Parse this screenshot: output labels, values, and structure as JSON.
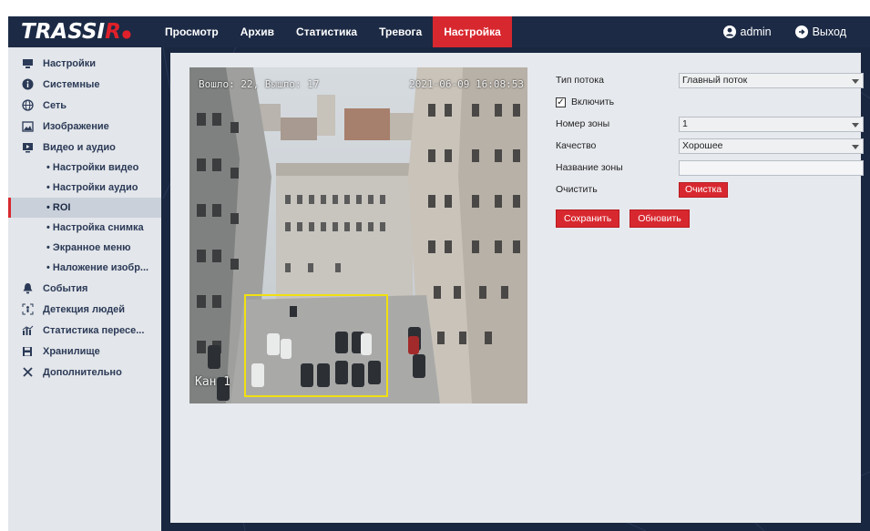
{
  "brand": {
    "logo_main": "TRASSI",
    "logo_accent": "R"
  },
  "nav": {
    "items": [
      {
        "label": "Просмотр"
      },
      {
        "label": "Архив"
      },
      {
        "label": "Статистика"
      },
      {
        "label": "Тревога"
      },
      {
        "label": "Настройка"
      }
    ],
    "active_index": 4,
    "user_label": "admin",
    "logout_label": "Выход"
  },
  "sidebar": {
    "items": [
      {
        "label": "Настройки",
        "icon": "monitor-icon"
      },
      {
        "label": "Системные",
        "icon": "info-icon"
      },
      {
        "label": "Сеть",
        "icon": "globe-icon"
      },
      {
        "label": "Изображение",
        "icon": "image-icon"
      },
      {
        "label": "Видео и аудио",
        "icon": "video-icon"
      }
    ],
    "video_sub": [
      {
        "label": "• Настройки видео"
      },
      {
        "label": "• Настройки аудио"
      },
      {
        "label": "• ROI"
      },
      {
        "label": "• Настройка снимка"
      },
      {
        "label": "• Экранное меню"
      },
      {
        "label": "• Наложение изобр..."
      }
    ],
    "active_sub_index": 2,
    "items_after": [
      {
        "label": "События",
        "icon": "bell-icon"
      },
      {
        "label": "Детекция людей",
        "icon": "person-detect-icon"
      },
      {
        "label": "Статистика пересе...",
        "icon": "chart-icon"
      },
      {
        "label": "Хранилище",
        "icon": "save-icon"
      },
      {
        "label": "Дополнительно",
        "icon": "tools-icon"
      }
    ]
  },
  "video": {
    "osd_left": "Вошло: 22, Вышло: 17",
    "osd_time": "2021-06-09 16:08:53",
    "osd_channel": "Кан 1"
  },
  "form": {
    "stream_type_label": "Тип потока",
    "stream_type_value": "Главный поток",
    "enable_label": "Включить",
    "enable_checked": true,
    "zone_number_label": "Номер зоны",
    "zone_number_value": "1",
    "quality_label": "Качество",
    "quality_value": "Хорошее",
    "zone_name_label": "Название зоны",
    "zone_name_value": "",
    "clear_label": "Очистить",
    "clear_button": "Очистка",
    "save_button": "Сохранить",
    "refresh_button": "Обновить"
  },
  "colors": {
    "accent": "#d8282f",
    "nav_bg": "#1c2a45",
    "roi_box": "#f0e010"
  }
}
